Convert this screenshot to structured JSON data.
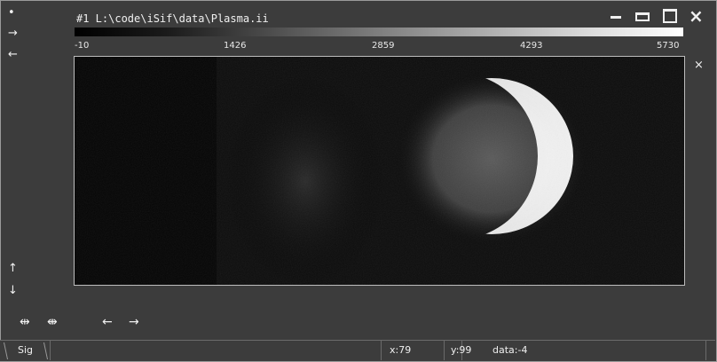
{
  "window": {
    "title": "#1  L:\\code\\iSif\\data\\Plasma.ii"
  },
  "colorbar": {
    "ticks": [
      "-10",
      "1426",
      "2859",
      "4293",
      "5730"
    ],
    "min": -10,
    "max": 5730,
    "colormap": "grayscale"
  },
  "side_icons": {
    "dot": "•",
    "arrow_right": "→",
    "arrow_left": "←",
    "arrow_up": "↑",
    "arrow_down": "↓"
  },
  "close_glyph": "×",
  "toolbar": {
    "expand_h": "⇹",
    "shrink_h": "⇼",
    "prev": "←",
    "next": "→"
  },
  "tabs": [
    {
      "label": "Sig",
      "active": true
    }
  ],
  "status": {
    "x": "x:79",
    "y": "y:99",
    "data": "data:-4"
  }
}
